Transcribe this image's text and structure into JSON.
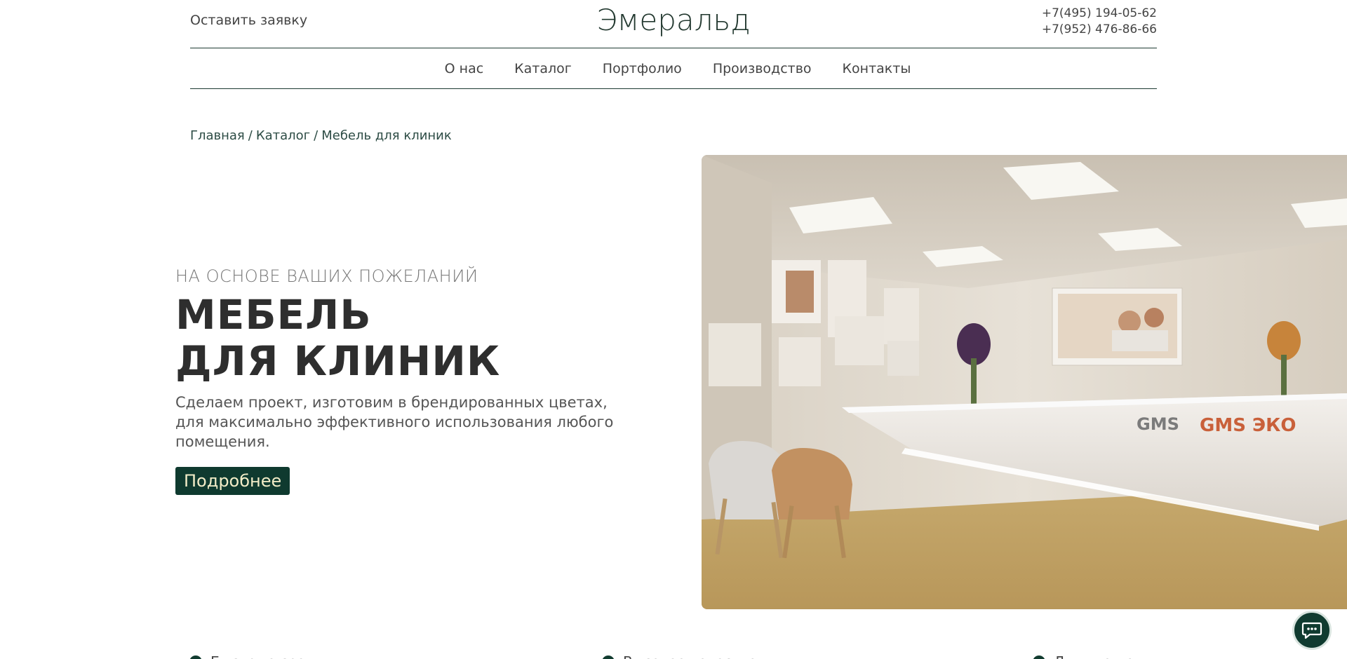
{
  "header": {
    "request_label": "Оставить заявку",
    "logo": "Эмеральд",
    "phones": [
      "+7(495) 194-05-62",
      "+7(952) 476-86-66"
    ]
  },
  "nav": {
    "items": [
      "О нас",
      "Каталог",
      "Портфолио",
      "Производство",
      "Контакты"
    ]
  },
  "breadcrumb": {
    "items": [
      "Главная",
      "Каталог",
      "Мебель для клиник"
    ],
    "separator": "/"
  },
  "hero": {
    "eyebrow": "НА ОСНОВЕ ВАШИХ ПОЖЕЛАНИЙ",
    "title_line1": "МЕБЕЛЬ",
    "title_line2": "ДЛЯ КЛИНИК",
    "description": "Сделаем проект, изготовим в брендированных цветах, для максимально эффективного использования любого помещения.",
    "button_label": "Подробнее",
    "image_logo_left": "GMS",
    "image_logo_right": "GMS ЭКО"
  },
  "features": {
    "items": [
      "Быстрые сроки",
      "Высокое качество",
      "Лучшие цены"
    ]
  },
  "chat": {
    "icon": "chat-bubble-icon"
  },
  "colors": {
    "accent": "#0f3a2f",
    "button_text": "#f3edc8",
    "text": "#333333"
  }
}
